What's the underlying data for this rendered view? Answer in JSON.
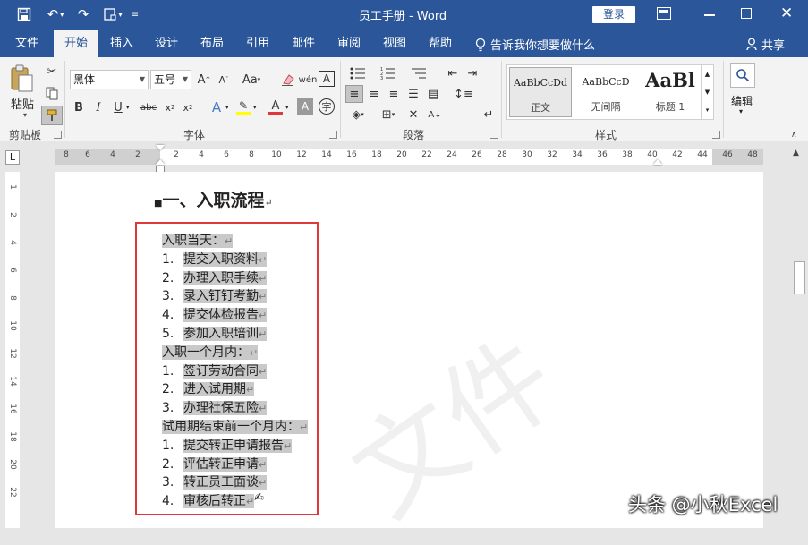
{
  "window": {
    "title": "员工手册 - Word",
    "login_label": "登录"
  },
  "tabs": [
    "文件",
    "开始",
    "插入",
    "设计",
    "布局",
    "引用",
    "邮件",
    "审阅",
    "视图",
    "帮助"
  ],
  "tell_me": "告诉我你想要做什么",
  "share_label": "共享",
  "ribbon": {
    "paste_label": "粘贴",
    "font_name": "黑体",
    "font_size": "五号",
    "styles": [
      {
        "preview": "AaBbCcDd",
        "name": "正文"
      },
      {
        "preview": "AaBbCcD",
        "name": "无间隔"
      },
      {
        "preview": "AaBl",
        "name": "标题 1"
      }
    ],
    "edit_label": "编辑",
    "groups": {
      "clipboard": "剪贴板",
      "font": "字体",
      "paragraph": "段落",
      "styles": "样式"
    }
  },
  "ruler": {
    "left_ticks": [
      "8",
      "6",
      "4",
      "2"
    ],
    "right_ticks": [
      "2",
      "4",
      "6",
      "8",
      "10",
      "12",
      "14",
      "16",
      "18",
      "20",
      "22",
      "24",
      "26",
      "28",
      "30",
      "32",
      "34",
      "36",
      "38",
      "40",
      "42",
      "44",
      "46",
      "48"
    ],
    "vertical_ticks": [
      "1",
      "2",
      "4",
      "6",
      "8",
      "10",
      "12",
      "14",
      "16",
      "18",
      "20",
      "22"
    ],
    "tab_selector": "L"
  },
  "document": {
    "heading": "一、入职流程",
    "paragraph_mark": "↵",
    "lines": [
      {
        "num": "",
        "text": "入职当天：",
        "indent": false
      },
      {
        "num": "1.",
        "text": "提交入职资料",
        "indent": true
      },
      {
        "num": "2.",
        "text": "办理入职手续",
        "indent": true
      },
      {
        "num": "3.",
        "text": "录入钉钉考勤",
        "indent": true
      },
      {
        "num": "4.",
        "text": "提交体检报告",
        "indent": true
      },
      {
        "num": "5.",
        "text": "参加入职培训",
        "indent": true
      },
      {
        "num": "",
        "text": "入职一个月内：",
        "indent": false
      },
      {
        "num": "1.",
        "text": "签订劳动合同",
        "indent": true
      },
      {
        "num": "2.",
        "text": "进入试用期",
        "indent": true
      },
      {
        "num": "3.",
        "text": "办理社保五险",
        "indent": true
      },
      {
        "num": "",
        "text": "试用期结束前一个月内：",
        "indent": false
      },
      {
        "num": "1.",
        "text": "提交转正申请报告",
        "indent": true
      },
      {
        "num": "2.",
        "text": "评估转正申请",
        "indent": true
      },
      {
        "num": "3.",
        "text": "转正员工面谈",
        "indent": true
      },
      {
        "num": "4.",
        "text": "审核后转正",
        "indent": true
      }
    ],
    "watermark": "文件",
    "credit": "头条 @小秋Excel"
  },
  "colors": {
    "accent": "#2b579a",
    "selection_box": "#e0383a",
    "highlight": "#c9c9c9"
  }
}
